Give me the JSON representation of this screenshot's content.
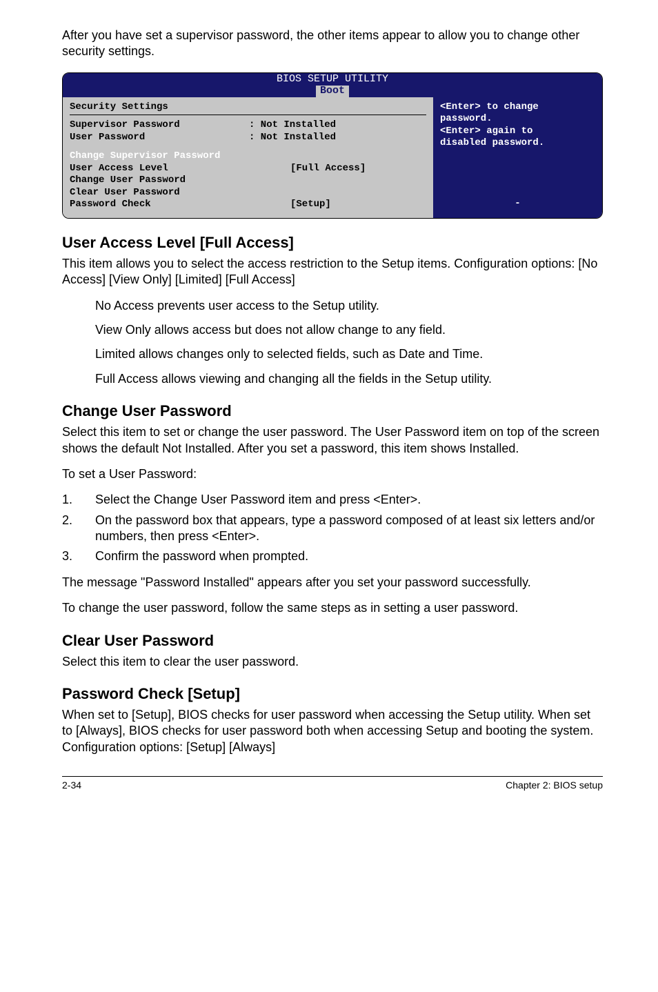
{
  "intro": "After you have set a supervisor password, the other items appear to allow you to change other security settings.",
  "bios": {
    "title_top": "BIOS SETUP UTILITY",
    "tab": "Boot",
    "section_title": "Security Settings",
    "rows": {
      "supervisor_label": "Supervisor Password",
      "supervisor_value": ": Not Installed",
      "user_label": "User Password",
      "user_value": ": Not Installed",
      "change_super": "Change Supervisor Password",
      "ual_label": "User Access Level",
      "ual_value": "[Full Access]",
      "change_user": "Change User Password",
      "clear_user": "Clear User Password",
      "pw_check_label": "Password Check",
      "pw_check_value": "[Setup]"
    },
    "side": {
      "l1": "<Enter> to change",
      "l2": "password.",
      "l3": "<Enter> again to",
      "l4": "disabled password.",
      "dash": "-"
    }
  },
  "sections": {
    "ual_heading": "User Access Level [Full Access]",
    "ual_p1": "This item allows you to select the access restriction to the Setup items. Configuration options: [No Access] [View Only] [Limited] [Full Access]",
    "ual_b1": "No Access prevents user access to the Setup utility.",
    "ual_b2": "View Only allows access but does not allow change to any field.",
    "ual_b3": "Limited allows changes only to selected fields, such as Date and Time.",
    "ual_b4": "Full Access allows viewing and changing all the fields in the Setup utility.",
    "cup_heading": "Change User Password",
    "cup_p1": "Select this item to set or change the user password. The User Password item on top of the screen shows the default Not Installed. After you set a password, this item shows Installed.",
    "cup_p2": "To set a User Password:",
    "cup_steps": {
      "s1": "Select the Change User Password item and press <Enter>.",
      "s2": "On the password box that appears, type a password composed of at least six letters and/or numbers, then press <Enter>.",
      "s3": "Confirm the password when prompted."
    },
    "cup_p3": "The message \"Password Installed\" appears after you set your password successfully.",
    "cup_p4": "To change the user password, follow the same steps as in setting a user password.",
    "clrup_heading": "Clear User Password",
    "clrup_p1": "Select this item to clear the user password.",
    "pwc_heading": "Password Check [Setup]",
    "pwc_p1": "When set to [Setup], BIOS checks for user password when accessing the Setup utility. When set to [Always], BIOS checks for user password both when accessing Setup and booting the system. Configuration options: [Setup] [Always]"
  },
  "footer": {
    "left": "2-34",
    "right": "Chapter 2: BIOS setup"
  }
}
